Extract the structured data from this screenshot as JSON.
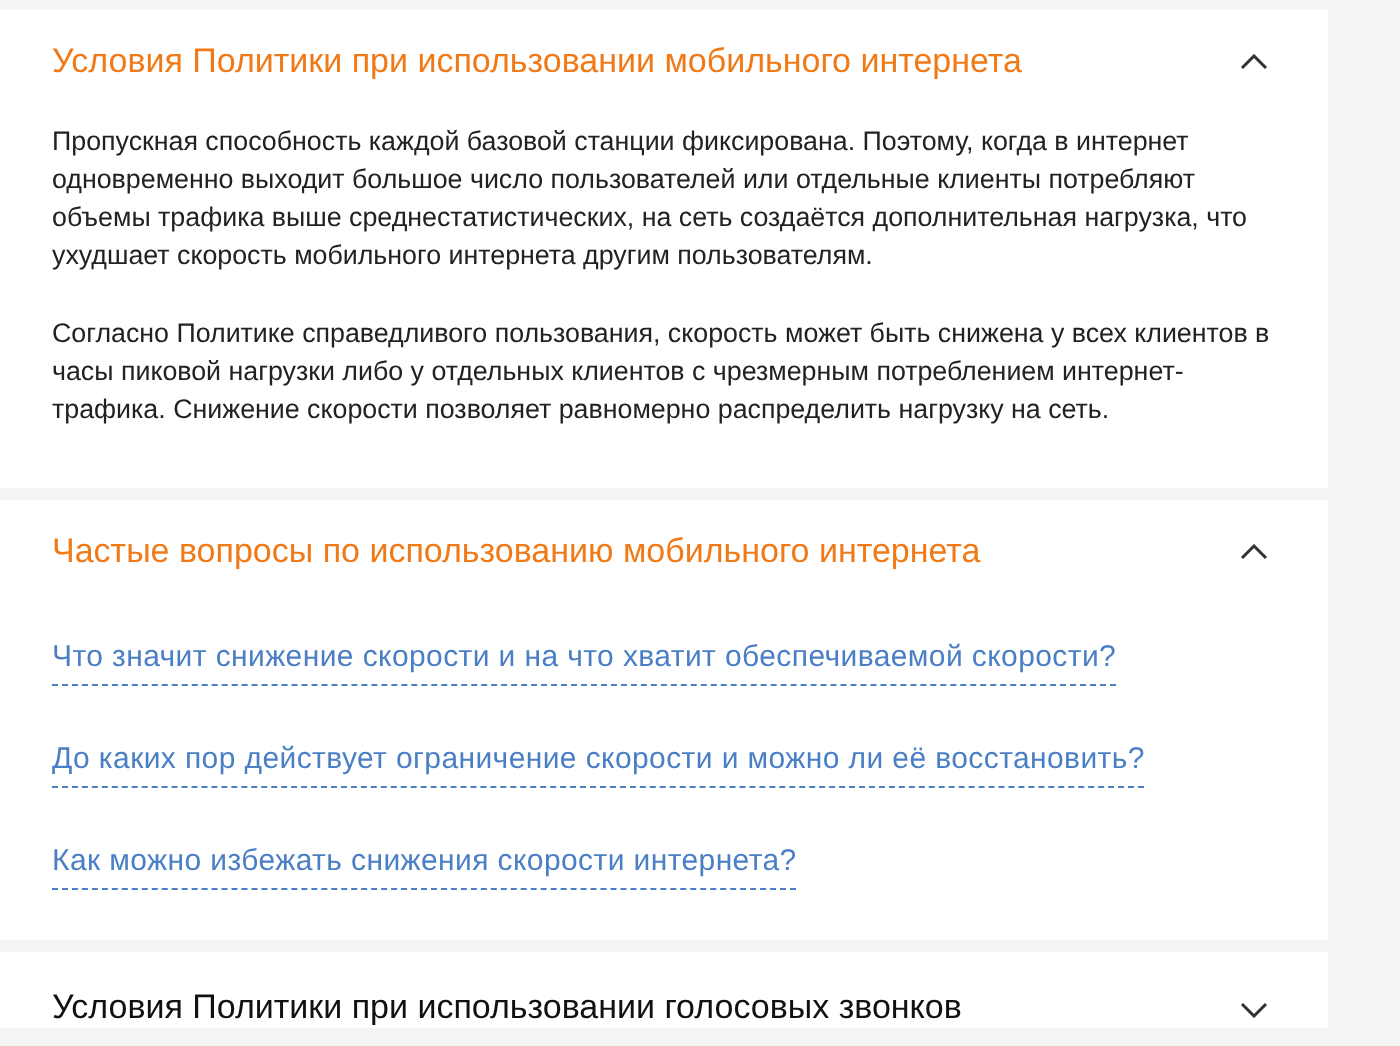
{
  "sections": [
    {
      "title": "Условия Политики при использовании мобильного интернета",
      "expanded": true,
      "kind": "text",
      "paragraphs": [
        "Пропускная способность каждой базовой станции фиксирована. Поэтому, когда в интернет одновременно выходит большое число пользователей или отдельные клиенты потребляют объемы трафика выше среднестатистических, на сеть создаётся дополнительная нагрузка, что ухудшает скорость мобильного интернета другим пользователям.",
        "Согласно Политике справедливого пользования, скорость может быть снижена у всех клиентов в часы пиковой нагрузки либо у отдельных клиентов с чрезмерным потреблением интернет-трафика. Снижение скорости позволяет равномерно распределить нагрузку на сеть."
      ]
    },
    {
      "title": "Частые вопросы по использованию мобильного интернета",
      "expanded": true,
      "kind": "questions",
      "questions": [
        "Что значит снижение скорости и на что хватит обеспечиваемой скорости?",
        "До каких пор действует ограничение скорости и можно ли её восстановить?",
        "Как можно избежать снижения скорости интернета?"
      ]
    },
    {
      "title": "Условия Политики при использовании голосовых звонков",
      "expanded": false
    }
  ]
}
